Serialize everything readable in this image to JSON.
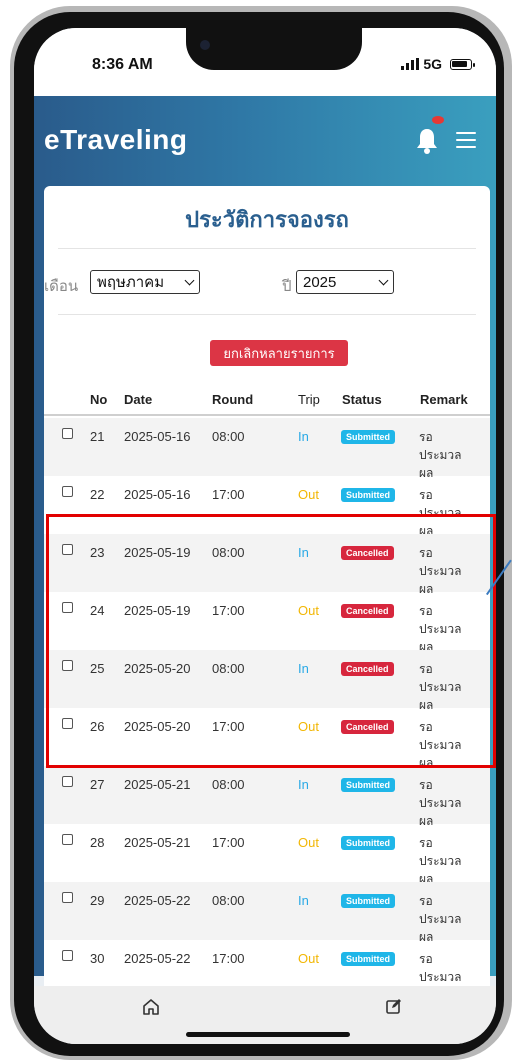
{
  "status_bar": {
    "time": "8:36 AM",
    "network": "5G"
  },
  "app": {
    "brand": "eTraveling",
    "bell_has_notification": true
  },
  "page": {
    "title": "ประวัติการจองรถ",
    "month_label": "เดือน",
    "month_value": "พฤษภาคม",
    "year_label": "ปี",
    "year_value": "2025",
    "cancel_multiple_label": "ยกเลิกหลายรายการ"
  },
  "table": {
    "headers": {
      "no": "No",
      "date": "Date",
      "round": "Round",
      "trip": "Trip",
      "status": "Status",
      "remark": "Remark"
    },
    "rows": [
      {
        "no": "21",
        "date": "2025-05-16",
        "round": "08:00",
        "trip": "In",
        "status": "Submitted",
        "remark": "รอประมวลผล"
      },
      {
        "no": "22",
        "date": "2025-05-16",
        "round": "17:00",
        "trip": "Out",
        "status": "Submitted",
        "remark": "รอประมวลผล"
      },
      {
        "no": "23",
        "date": "2025-05-19",
        "round": "08:00",
        "trip": "In",
        "status": "Cancelled",
        "remark": "รอประมวลผล"
      },
      {
        "no": "24",
        "date": "2025-05-19",
        "round": "17:00",
        "trip": "Out",
        "status": "Cancelled",
        "remark": "รอประมวลผล"
      },
      {
        "no": "25",
        "date": "2025-05-20",
        "round": "08:00",
        "trip": "In",
        "status": "Cancelled",
        "remark": "รอประมวลผล"
      },
      {
        "no": "26",
        "date": "2025-05-20",
        "round": "17:00",
        "trip": "Out",
        "status": "Cancelled",
        "remark": "รอประมวลผล"
      },
      {
        "no": "27",
        "date": "2025-05-21",
        "round": "08:00",
        "trip": "In",
        "status": "Submitted",
        "remark": "รอประมวลผล"
      },
      {
        "no": "28",
        "date": "2025-05-21",
        "round": "17:00",
        "trip": "Out",
        "status": "Submitted",
        "remark": "รอประมวลผล"
      },
      {
        "no": "29",
        "date": "2025-05-22",
        "round": "08:00",
        "trip": "In",
        "status": "Submitted",
        "remark": "รอประมวลผล"
      },
      {
        "no": "30",
        "date": "2025-05-22",
        "round": "17:00",
        "trip": "Out",
        "status": "Submitted",
        "remark": "รอประมวลผล"
      }
    ]
  },
  "colors": {
    "header_gradient_start": "#2a5b8b",
    "header_gradient_end": "#3a9fbf",
    "title": "#2a5f8f",
    "cancel_button": "#dc3545",
    "trip_in": "#29a9e6",
    "trip_out": "#f2b705",
    "badge_submitted": "#1fb6e8",
    "badge_cancelled": "#d7263d",
    "highlight": "#e20000"
  },
  "icons": {
    "bell": "bell-icon",
    "menu": "hamburger-icon",
    "home": "home-icon",
    "edit": "edit-icon",
    "dropdown": "chevron-down-icon"
  },
  "bottom_nav": {
    "items": [
      "home",
      "edit"
    ]
  }
}
